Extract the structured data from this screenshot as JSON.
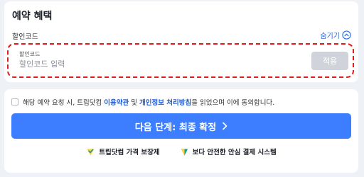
{
  "discount_section": {
    "title": "예약 혜택",
    "field_label": "할인코드",
    "toggle_label": "숨기기",
    "input_float_label": "할인코드",
    "input_placeholder": "할인코드 입력",
    "input_value": "",
    "apply_label": "적용"
  },
  "consent": {
    "prefix": "해당 예약 요청 시, 트립닷컴 ",
    "terms_link": "이용약관",
    "and": " 및 ",
    "privacy_link": "개인정보 처리방침",
    "suffix": "을 읽었으며 이에 동의합니다.",
    "checked": false
  },
  "cta": {
    "label": "다음 단계: 최종 확정"
  },
  "badges": [
    {
      "icon": "check-shield-icon",
      "label": "트립닷컴 가격 보장제"
    },
    {
      "icon": "shield-icon",
      "label": "보다 안전한 안심 결제 시스템"
    }
  ],
  "colors": {
    "accent": "#3d7dff",
    "link": "#1e5bd6",
    "highlight_border": "#e01b1b",
    "disabled_button": "#d0d4da"
  }
}
